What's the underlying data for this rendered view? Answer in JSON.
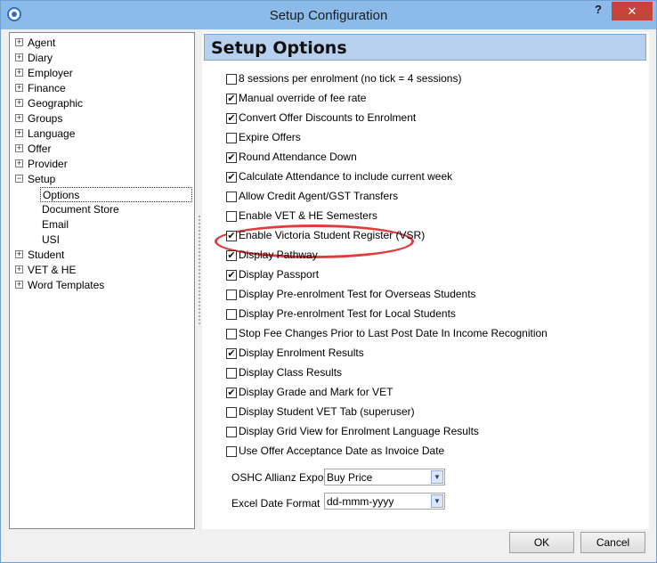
{
  "window": {
    "title": "Setup Configuration",
    "help_label": "?",
    "close_label": "✕"
  },
  "tree": {
    "expand_glyph": "+",
    "collapse_glyph": "−",
    "items": [
      {
        "label": "Agent",
        "expanded": false
      },
      {
        "label": "Diary",
        "expanded": false
      },
      {
        "label": "Employer",
        "expanded": false
      },
      {
        "label": "Finance",
        "expanded": false
      },
      {
        "label": "Geographic",
        "expanded": false
      },
      {
        "label": "Groups",
        "expanded": false
      },
      {
        "label": "Language",
        "expanded": false
      },
      {
        "label": "Offer",
        "expanded": false
      },
      {
        "label": "Provider",
        "expanded": false
      },
      {
        "label": "Setup",
        "expanded": true
      },
      {
        "label": "Options",
        "child": true,
        "selected": true
      },
      {
        "label": "Document Store",
        "child": true
      },
      {
        "label": "Email",
        "child": true
      },
      {
        "label": "USI",
        "child": true
      },
      {
        "label": "Student",
        "expanded": false
      },
      {
        "label": "VET & HE",
        "expanded": false
      },
      {
        "label": "Word Templates",
        "expanded": false
      }
    ]
  },
  "panel": {
    "header": "Setup Options",
    "check_glyph": "✔",
    "options": [
      {
        "label": "8 sessions per enrolment (no tick = 4 sessions)",
        "checked": false
      },
      {
        "label": "Manual override of fee rate",
        "checked": true
      },
      {
        "label": "Convert Offer Discounts to Enrolment",
        "checked": true
      },
      {
        "label": "Expire Offers",
        "checked": false
      },
      {
        "label": "Round Attendance Down",
        "checked": true
      },
      {
        "label": "Calculate Attendance to include current week",
        "checked": true
      },
      {
        "label": "Allow Credit Agent/GST Transfers",
        "checked": false
      },
      {
        "label": "Enable VET & HE Semesters",
        "checked": false
      },
      {
        "label": "Enable Victoria Student Register (VSR)",
        "checked": true
      },
      {
        "label": "Display Pathway",
        "checked": true
      },
      {
        "label": "Display Passport",
        "checked": true
      },
      {
        "label": "Display Pre-enrolment Test for Overseas Students",
        "checked": false
      },
      {
        "label": "Display Pre-enrolment Test for Local Students",
        "checked": false
      },
      {
        "label": "Stop Fee Changes Prior to Last Post Date In Income Recognition",
        "checked": false
      },
      {
        "label": "Display Enrolment Results",
        "checked": true
      },
      {
        "label": "Display Class Results",
        "checked": false
      },
      {
        "label": "Display Grade and Mark for VET",
        "checked": true
      },
      {
        "label": "Display Student VET Tab (superuser)",
        "checked": false
      },
      {
        "label": "Display Grid View for Enrolment Language Results",
        "checked": false
      },
      {
        "label": "Use Offer Acceptance Date as Invoice Date",
        "checked": false
      }
    ],
    "oshc": {
      "label": "OSHC Allianz Export",
      "value": "Buy Price"
    },
    "excel": {
      "label": "Excel Date Format",
      "value": "dd-mmm-yyyy"
    }
  },
  "buttons": {
    "ok": "OK",
    "cancel": "Cancel"
  },
  "colors": {
    "highlight_ring": "#e03c3c",
    "title_bar": "#8cbbea",
    "header_bg": "#b7d0ee"
  }
}
